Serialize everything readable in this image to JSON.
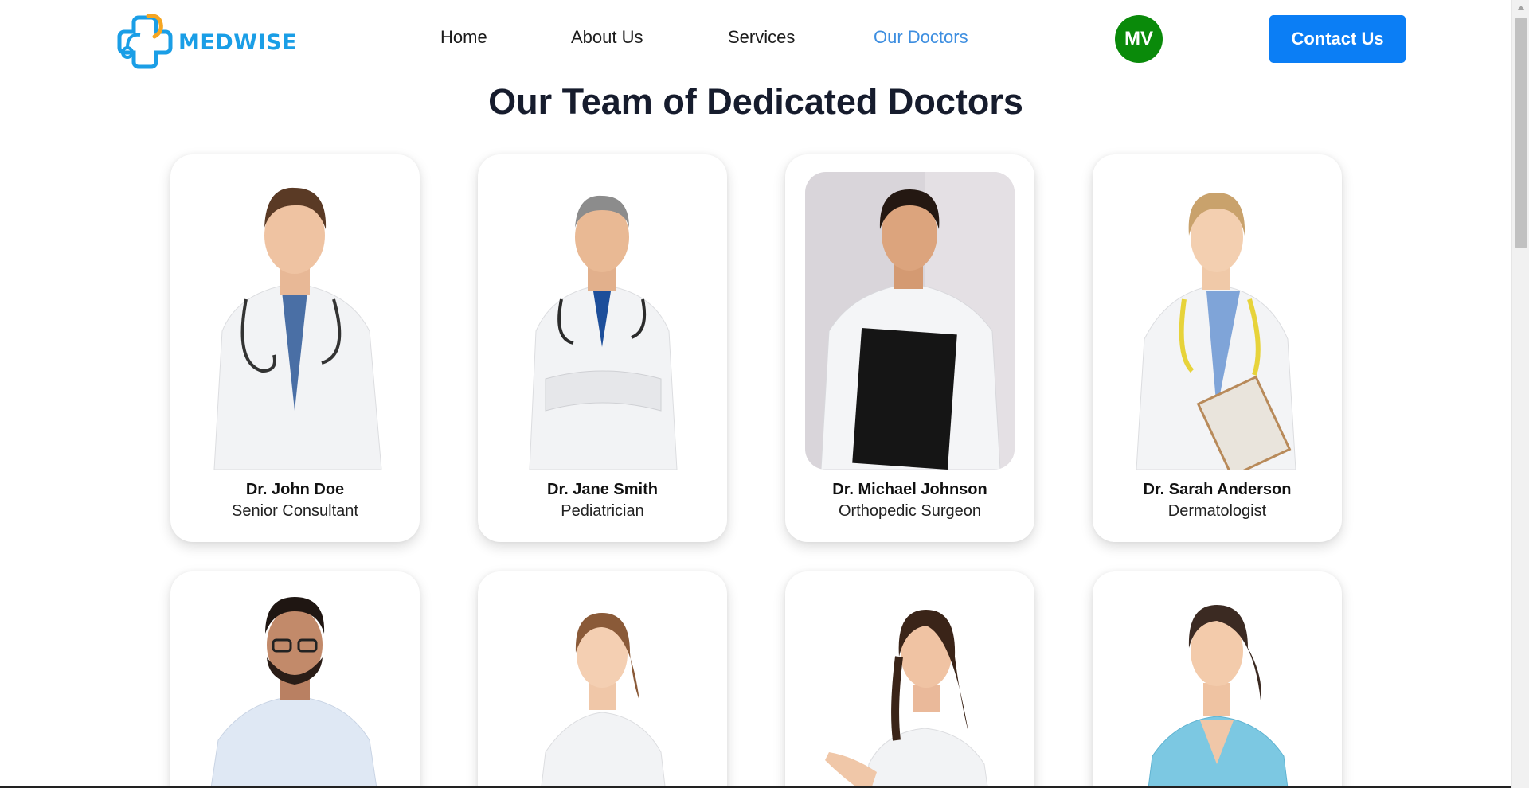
{
  "brand": {
    "name": "MEDWISE",
    "logo_icon": "medical-cross-stethoscope-icon",
    "color": "#1a9ee6",
    "accent": "#f5a623"
  },
  "nav": {
    "items": [
      {
        "label": "Home",
        "active": false
      },
      {
        "label": "About Us",
        "active": false
      },
      {
        "label": "Services",
        "active": false
      },
      {
        "label": "Our Doctors",
        "active": true
      }
    ],
    "active_color": "#3d8ee0"
  },
  "user": {
    "initials": "MV",
    "avatar_color": "#0a8a0a"
  },
  "contact_button": {
    "label": "Contact Us",
    "color": "#0b7ef5"
  },
  "page_title": "Our Team of Dedicated Doctors",
  "doctors": [
    {
      "name": "Dr. John Doe",
      "role": "Senior Consultant"
    },
    {
      "name": "Dr. Jane Smith",
      "role": "Pediatrician"
    },
    {
      "name": "Dr. Michael Johnson",
      "role": "Orthopedic Surgeon"
    },
    {
      "name": "Dr. Sarah Anderson",
      "role": "Dermatologist"
    },
    {
      "name": "",
      "role": ""
    },
    {
      "name": "",
      "role": ""
    },
    {
      "name": "",
      "role": ""
    },
    {
      "name": "",
      "role": ""
    }
  ]
}
